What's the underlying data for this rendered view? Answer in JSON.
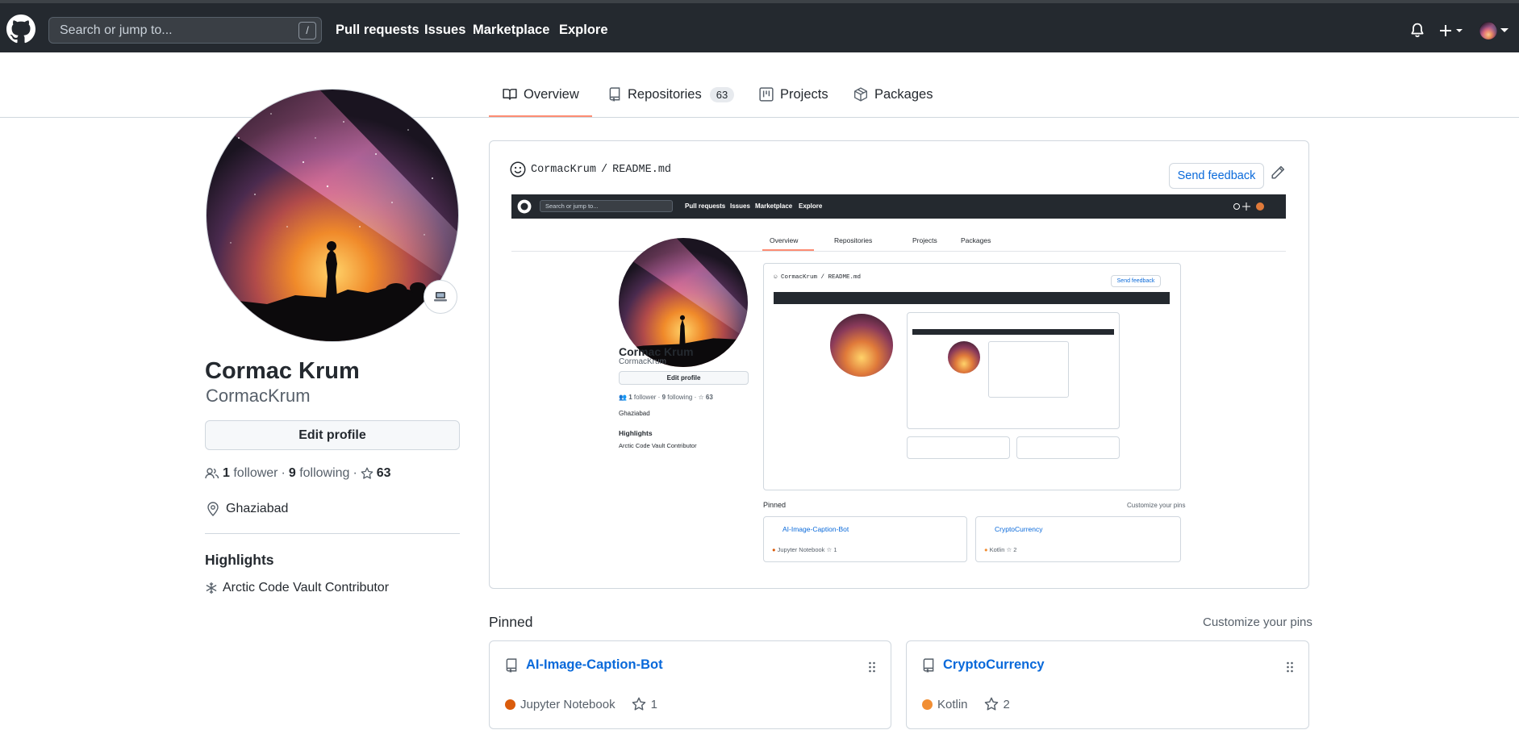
{
  "header": {
    "search_placeholder": "Search or jump to...",
    "search_shortcut": "/",
    "nav": [
      "Pull requests",
      "Issues",
      "Marketplace",
      "Explore"
    ],
    "icons": [
      "github-logo",
      "bell-icon",
      "plus-icon",
      "avatar-menu"
    ]
  },
  "tabs": [
    {
      "label": "Overview",
      "icon": "book-icon",
      "active": true
    },
    {
      "label": "Repositories",
      "icon": "repo-icon",
      "count": "63"
    },
    {
      "label": "Projects",
      "icon": "project-icon"
    },
    {
      "label": "Packages",
      "icon": "package-icon"
    }
  ],
  "profile": {
    "name": "Cormac Krum",
    "username": "CormacKrum",
    "edit_label": "Edit profile",
    "followers": "1",
    "followers_label": "follower",
    "following": "9",
    "following_label": "following",
    "stars": "63",
    "location": "Ghaziabad",
    "highlights_title": "Highlights",
    "highlight_item": "Arctic Code Vault Contributor"
  },
  "readme": {
    "owner": "CormacKrum",
    "sep": "/",
    "file": "README.md",
    "feedback_label": "Send feedback"
  },
  "pinned": {
    "title": "Pinned",
    "customize_label": "Customize your pins",
    "repos": [
      {
        "name": "AI-Image-Caption-Bot",
        "language": "Jupyter Notebook",
        "color": "#DA5B0B",
        "stars": "1"
      },
      {
        "name": "CryptoCurrency",
        "language": "Kotlin",
        "color": "#F18E33",
        "stars": "2"
      }
    ]
  },
  "colors": {
    "header_bg": "#24292f",
    "link": "#0969da",
    "tab_underline": "#fd8c73"
  }
}
